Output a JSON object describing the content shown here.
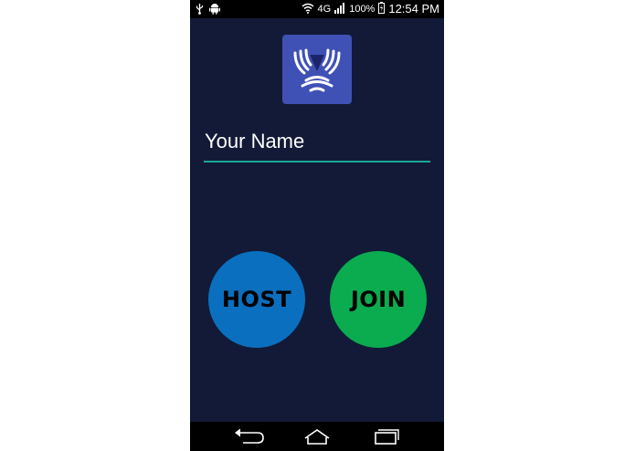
{
  "status_bar": {
    "network": "4G",
    "battery": "100%",
    "time": "12:54 PM",
    "icons": [
      "usb-icon",
      "android-icon",
      "wifi-icon",
      "signal-icon",
      "battery-icon"
    ]
  },
  "logo": {
    "icon": "app-logo-icon",
    "background": "#3f51b5"
  },
  "name_input": {
    "placeholder": "Your Name",
    "value": "",
    "underline_color": "#1ca89a"
  },
  "buttons": {
    "host": {
      "label": "HOST",
      "color": "#0a6fbe"
    },
    "join": {
      "label": "JOIN",
      "color": "#0aac4f"
    }
  },
  "nav_bar": {
    "icons": [
      "back-icon",
      "home-icon",
      "recent-apps-icon"
    ]
  },
  "colors": {
    "screen_background": "#121a37"
  }
}
